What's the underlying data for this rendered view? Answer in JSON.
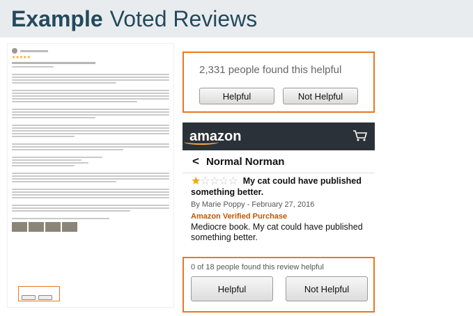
{
  "header": {
    "bold": "Example",
    "light": "Voted Reviews"
  },
  "card1": {
    "count": "2,331 people found this helpful",
    "helpful": "Helpful",
    "not_helpful": "Not Helpful"
  },
  "amazon": {
    "logo": "amazon",
    "reviewer": "Normal Norman",
    "rating": 1,
    "title_line1": "My cat could have published",
    "title_line2": "something better.",
    "byline": "By Marie Poppy - February 27, 2016",
    "verified": "Amazon Verified Purchase",
    "body_line1": "Mediocre book. My cat could have published",
    "body_line2": "something better.",
    "helpful_count": "0 of 18 people found this review helpful",
    "helpful": "Helpful",
    "not_helpful": "Not Helpful"
  },
  "colors": {
    "accent": "#e87722",
    "header_text": "#234a5c",
    "header_bg": "#e9ecef",
    "verified": "#c45500",
    "star": "#f0a500"
  }
}
